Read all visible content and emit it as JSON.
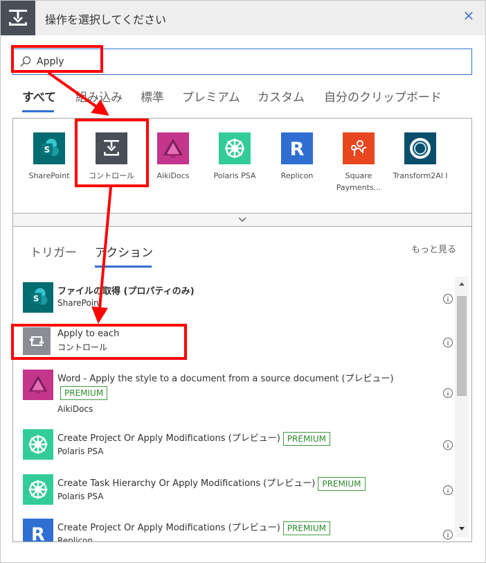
{
  "header": {
    "title": "操作を選択してください",
    "close": "✕"
  },
  "search": {
    "value": "Apply",
    "placeholder": ""
  },
  "tabs": [
    {
      "label": "すべて",
      "active": true
    },
    {
      "label": "組み込み"
    },
    {
      "label": "標準"
    },
    {
      "label": "プレミアム"
    },
    {
      "label": "カスタム"
    },
    {
      "label": "自分のクリップボード"
    }
  ],
  "connectors": [
    {
      "label": "SharePoint",
      "color": "#036c70"
    },
    {
      "label": "コントロール",
      "color": "#484f58"
    },
    {
      "label": "AikiDocs",
      "color": "#c4358c"
    },
    {
      "label": "Polaris PSA",
      "color": "#33cc99"
    },
    {
      "label": "Replicon",
      "color": "#2f6fd1"
    },
    {
      "label": "Square Payments...",
      "color": "#e8461e"
    },
    {
      "label": "Transform2Al l",
      "color": "#0b4f6c"
    }
  ],
  "sub_tabs": [
    {
      "label": "トリガー"
    },
    {
      "label": "アクション",
      "active": true
    }
  ],
  "more_link": "もっと見る",
  "actions": [
    {
      "title": "ファイルの取得 (プロパティのみ)",
      "connector": "SharePoint",
      "premium": false,
      "icon": "sharepoint-icon"
    },
    {
      "title": "Apply to each",
      "connector": "コントロール",
      "premium": false,
      "icon": "loop-icon"
    },
    {
      "title": "Word - Apply the style to a document from a source document (プレビュー)",
      "connector": "AikiDocs",
      "premium": true,
      "icon": "aikidocs-icon"
    },
    {
      "title": "Create Project Or Apply Modifications (プレビュー)",
      "connector": "Polaris PSA",
      "premium": true,
      "icon": "polaris-icon"
    },
    {
      "title": "Create Task Hierarchy Or Apply Modifications (プレビュー)",
      "connector": "Polaris PSA",
      "premium": true,
      "icon": "polaris-icon"
    },
    {
      "title": "Create Project Or Apply Modifications (プレビュー)",
      "connector": "Replicon",
      "premium": true,
      "icon": "replicon-icon"
    }
  ],
  "premium_label": "PREMIUM",
  "colors": {
    "accent": "#2f6fd1",
    "annotation": "#ff0000",
    "premium": "#3c9f3c"
  }
}
